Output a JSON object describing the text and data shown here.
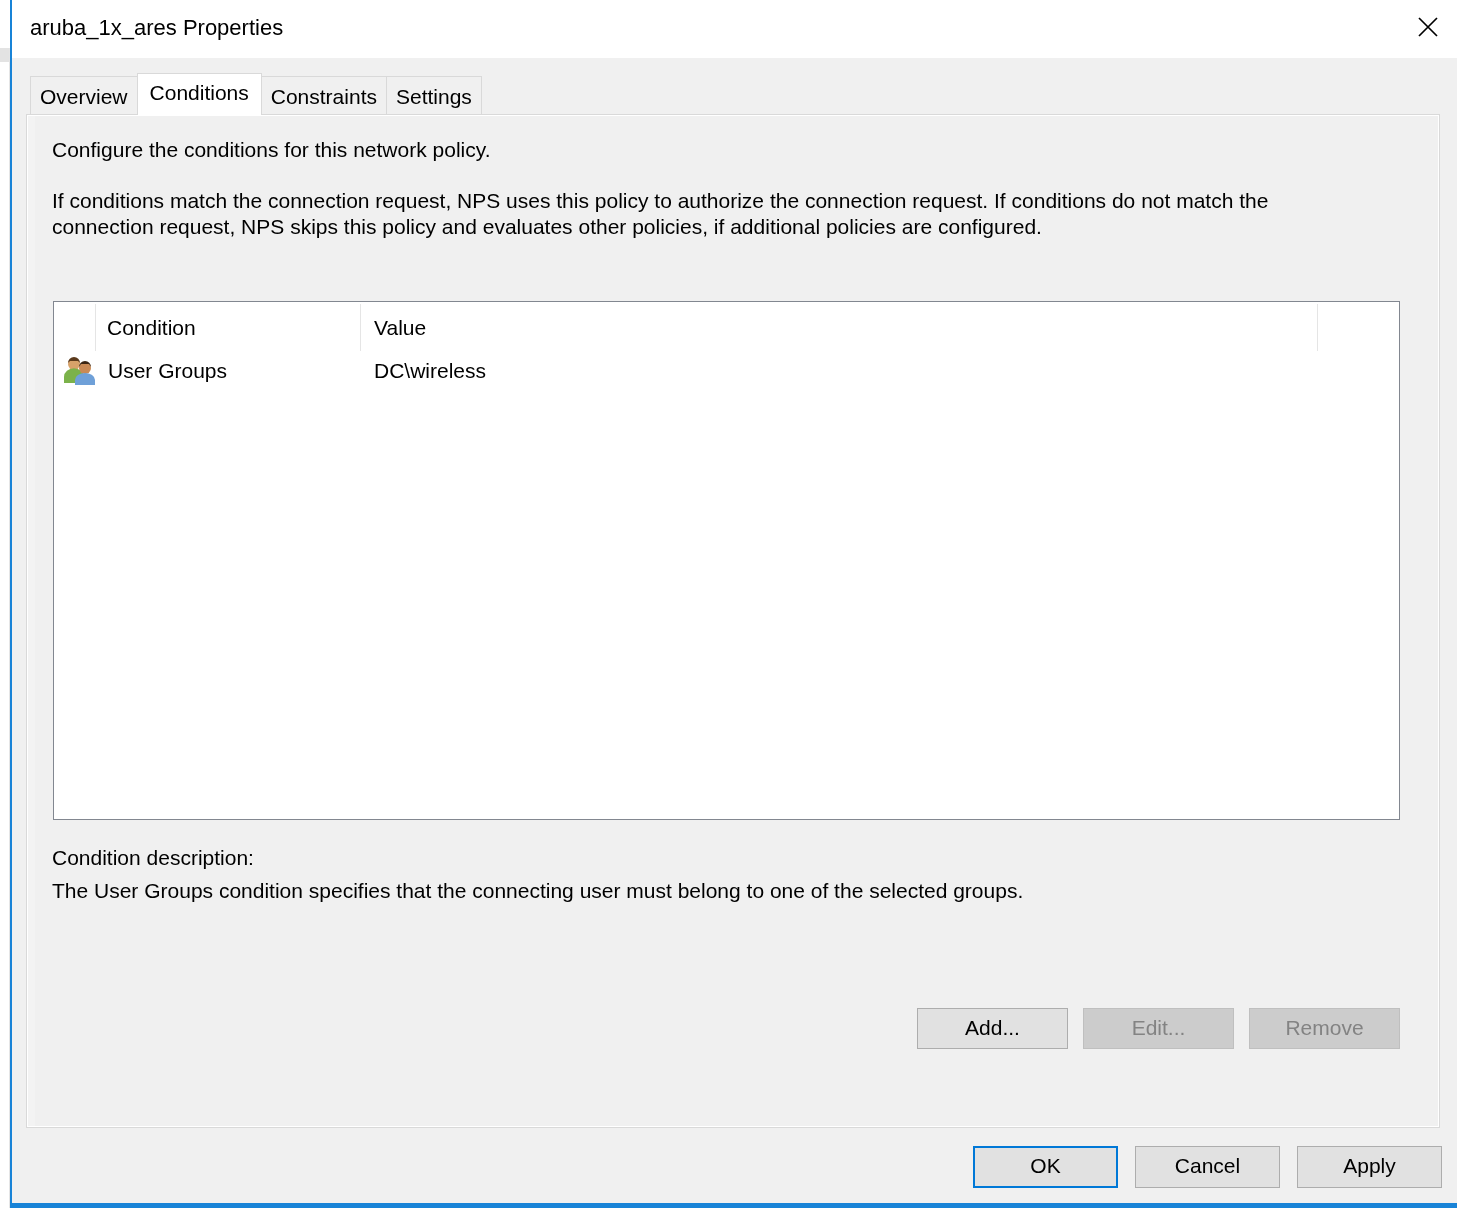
{
  "window": {
    "title": "aruba_1x_ares Properties"
  },
  "tabs": [
    {
      "label": "Overview",
      "selected": false
    },
    {
      "label": "Conditions",
      "selected": true
    },
    {
      "label": "Constraints",
      "selected": false
    },
    {
      "label": "Settings",
      "selected": false
    }
  ],
  "page": {
    "heading": "Configure the conditions for this network policy.",
    "explanation": "If conditions match the connection request, NPS uses this policy to authorize the connection request. If conditions do not match the connection request, NPS skips this policy and evaluates other policies, if additional policies are configured."
  },
  "conditions_table": {
    "columns": [
      "Condition",
      "Value"
    ],
    "rows": [
      {
        "condition": "User Groups",
        "value": "DC\\wireless",
        "selected": false
      }
    ]
  },
  "condition_description": {
    "label": "Condition description:",
    "text": "The User Groups condition specifies that the connecting user must belong to one of the selected groups."
  },
  "list_buttons": [
    {
      "label": "Add...",
      "disabled": false
    },
    {
      "label": "Edit...",
      "disabled": true
    },
    {
      "label": "Remove",
      "disabled": true
    }
  ],
  "dialog_buttons": [
    {
      "label": "OK",
      "default": true
    },
    {
      "label": "Cancel",
      "default": false
    },
    {
      "label": "Apply",
      "default": false
    }
  ]
}
